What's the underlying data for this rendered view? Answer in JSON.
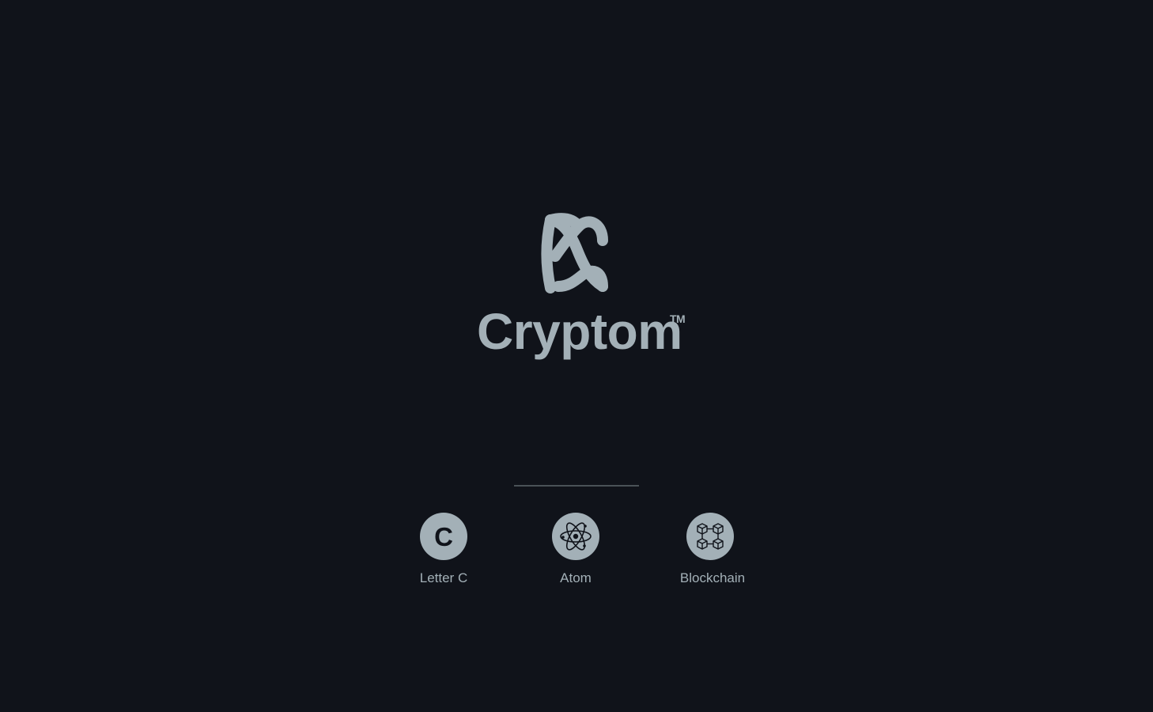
{
  "brand": {
    "name": "Cryptom",
    "trademark": "TM",
    "mark_icon": "cryptom-logo-icon"
  },
  "concepts": [
    {
      "label": "Letter C",
      "glyph": "C",
      "icon": "letter-c-icon"
    },
    {
      "label": "Atom",
      "icon": "atom-icon"
    },
    {
      "label": "Blockchain",
      "icon": "blockchain-icon"
    }
  ],
  "colors": {
    "background": "#10131a",
    "foreground": "#a3b0b7",
    "divider": "#4a5257"
  }
}
